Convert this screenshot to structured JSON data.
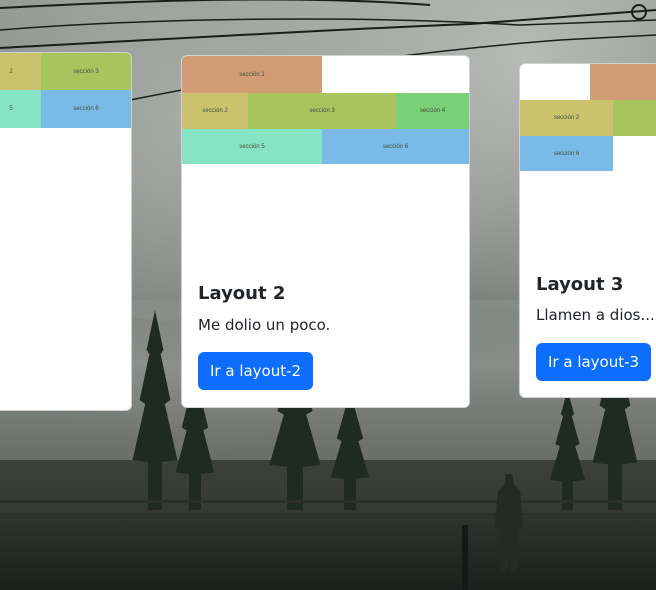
{
  "cards": [
    {
      "sections": [
        "2",
        "sección 3",
        "5",
        "sección 6"
      ]
    },
    {
      "title": "Layout 2",
      "text": "Me dolio un poco.",
      "button": "Ir a layout-2",
      "sections": [
        "sección 1",
        "sección 2",
        "sección 3",
        "sección 4",
        "sección 5",
        "sección 6"
      ]
    },
    {
      "title": "Layout 3",
      "text": "Llamen a dios...",
      "button": "Ir a layout-3",
      "sections": [
        "sección 2",
        "sección 6"
      ]
    }
  ],
  "colors": {
    "primary": "#0d6efd",
    "sec1": "#d19d74",
    "sec2": "#cbc26d",
    "sec3": "#a8c55d",
    "sec4": "#7bcf76",
    "sec5": "#86e3c4",
    "sec6": "#79bbe6"
  }
}
